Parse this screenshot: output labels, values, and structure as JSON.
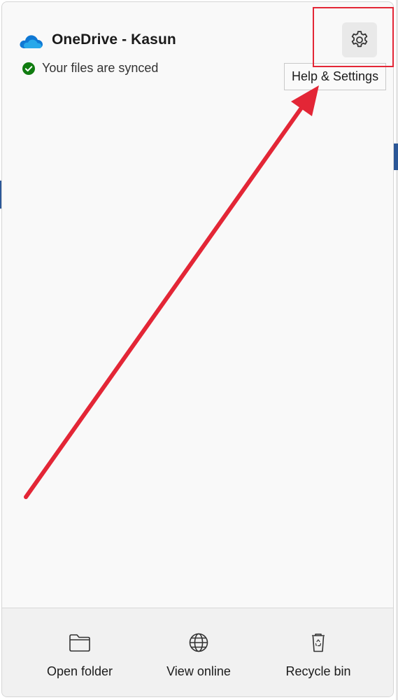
{
  "header": {
    "title": "OneDrive - Kasun",
    "status_text": "Your files are synced",
    "cloud_icon": "onedrive-cloud-icon",
    "status_icon": "check-circle-icon",
    "status_color": "#107c10",
    "brand_color": "#0364b8"
  },
  "settings": {
    "icon": "gear-icon",
    "tooltip": "Help & Settings"
  },
  "annotation": {
    "color": "#e32636"
  },
  "footer": {
    "buttons": [
      {
        "label": "Open folder",
        "icon": "folder-icon"
      },
      {
        "label": "View online",
        "icon": "globe-icon"
      },
      {
        "label": "Recycle bin",
        "icon": "recycle-bin-icon"
      }
    ]
  }
}
